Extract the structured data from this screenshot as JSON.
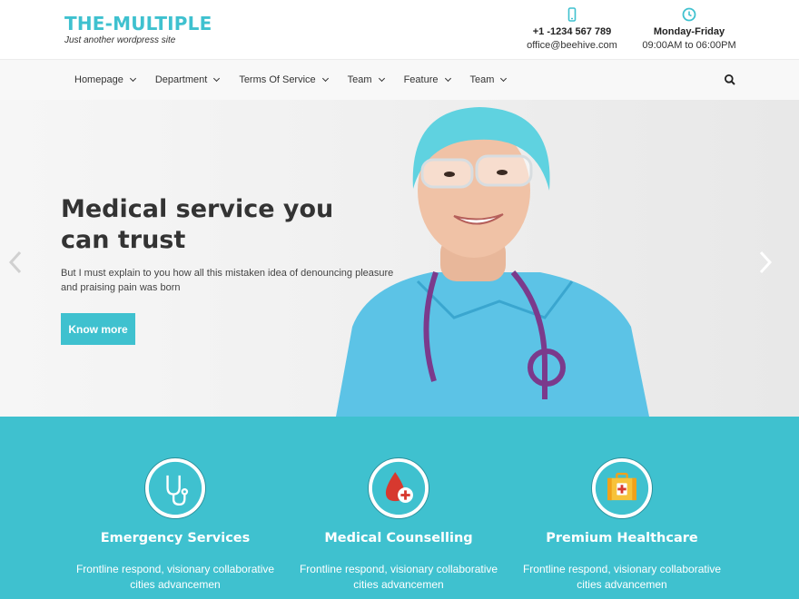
{
  "brand": {
    "title": "THE-MULTIPLE",
    "tagline": "Just another wordpress site"
  },
  "contact": {
    "phone": {
      "icon": "mobile-phone-icon",
      "line1": "+1 -1234 567 789",
      "line2": "office@beehive.com"
    },
    "hours": {
      "icon": "clock-icon",
      "line1": "Monday-Friday",
      "line2": "09:00AM to 06:00PM"
    }
  },
  "nav": {
    "items": [
      {
        "label": "Homepage"
      },
      {
        "label": "Department"
      },
      {
        "label": "Terms Of Service"
      },
      {
        "label": "Team"
      },
      {
        "label": "Feature"
      },
      {
        "label": "Team"
      }
    ],
    "search_icon": "search-icon"
  },
  "hero": {
    "title": "Medical service you can trust",
    "text": "But I must explain to you how all this mistaken idea of denouncing pleasure and praising pain was born",
    "button": "Know more",
    "prev_icon": "chevron-left-icon",
    "next_icon": "chevron-right-icon"
  },
  "features": [
    {
      "icon": "stethoscope-icon",
      "title": "Emergency Services",
      "text": "Frontline respond, visionary collaborative cities advancemen"
    },
    {
      "icon": "blood-drop-icon",
      "title": "Medical Counselling",
      "text": "Frontline respond, visionary collaborative cities advancemen"
    },
    {
      "icon": "first-aid-kit-icon",
      "title": "Premium Healthcare",
      "text": "Frontline respond, visionary collaborative cities advancemen"
    }
  ],
  "colors": {
    "accent": "#3fc1cf",
    "text_dark": "#333333",
    "nav_bg": "#f8f8f8"
  }
}
